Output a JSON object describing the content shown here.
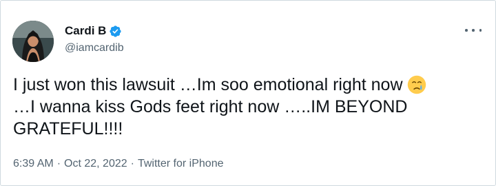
{
  "user": {
    "display_name": "Cardi B",
    "handle": "@iamcardib",
    "avatar_icon": "avatar-photo",
    "verified_icon": "verified-badge-icon",
    "verified_color": "#1d9bf0"
  },
  "tweet": {
    "line1": "I just won this lawsuit …Im soo emotional right now",
    "emoji": "face-holding-back-tears-emoji",
    "line2": "…I wanna kiss Gods feet right now …..IM BEYOND GRATEFUL!!!!"
  },
  "meta": {
    "time": "6:39 AM",
    "separator1": "·",
    "date": "Oct 22, 2022",
    "separator2": "·",
    "source": "Twitter for iPhone"
  },
  "more_icon": "more-dots-icon"
}
